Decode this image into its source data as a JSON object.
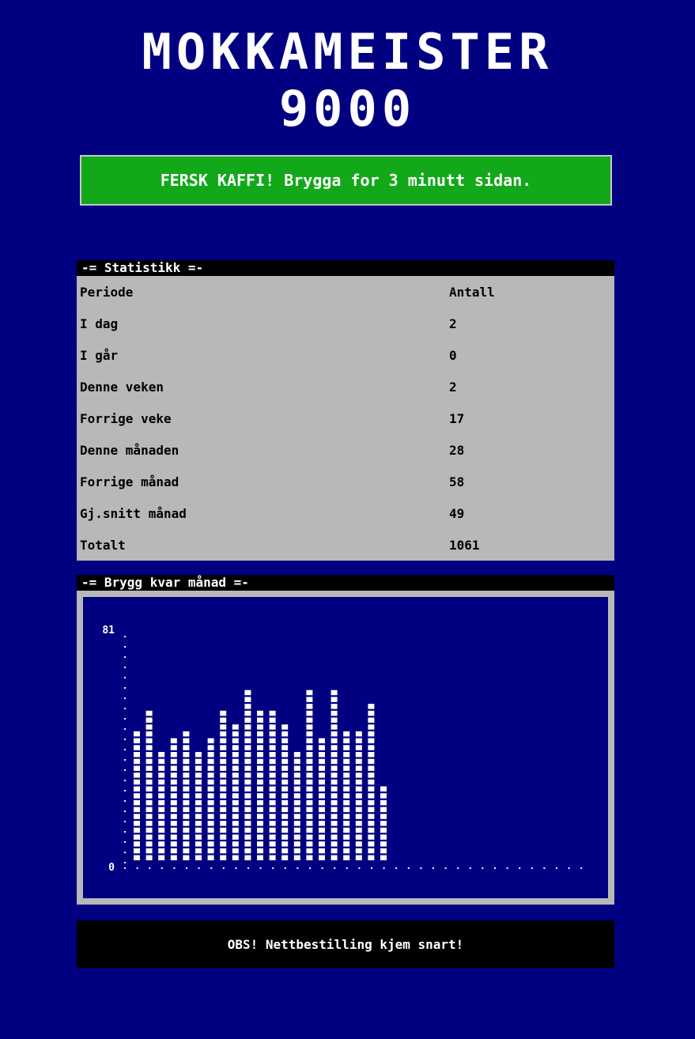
{
  "header": {
    "title_line1": "MOKKAMEISTER",
    "title_line2": "9000"
  },
  "status": {
    "banner": "FERSK KAFFI! Brygga for 3 minutt sidan.",
    "color": "#12a81a"
  },
  "stats": {
    "heading": "-= Statistikk =-",
    "columns": [
      "Periode",
      "Antall"
    ],
    "rows": [
      {
        "period": "I dag",
        "count": "2"
      },
      {
        "period": "I går",
        "count": "0"
      },
      {
        "period": "Denne veken",
        "count": "2"
      },
      {
        "period": "Forrige veke",
        "count": "17"
      },
      {
        "period": "Denne månaden",
        "count": "28"
      },
      {
        "period": "Forrige månad",
        "count": "58"
      },
      {
        "period": "Gj.snitt månad",
        "count": "49"
      },
      {
        "period": "Totalt",
        "count": "1061"
      }
    ]
  },
  "chart": {
    "heading": "-= Brygg kvar månad =-"
  },
  "chart_data": {
    "type": "bar",
    "title": "-= Brygg kvar månad =-",
    "ymax_label": "81",
    "ymin_label": "0",
    "ylim": [
      0,
      81
    ],
    "slots": 38,
    "values": [
      46,
      54,
      40,
      44,
      46,
      40,
      44,
      54,
      50,
      62,
      54,
      54,
      50,
      40,
      62,
      44,
      62,
      46,
      46,
      58,
      28
    ],
    "grid": false,
    "legend": "none"
  },
  "footer": {
    "notice": "OBS! Nettbestilling kjem snart!"
  }
}
